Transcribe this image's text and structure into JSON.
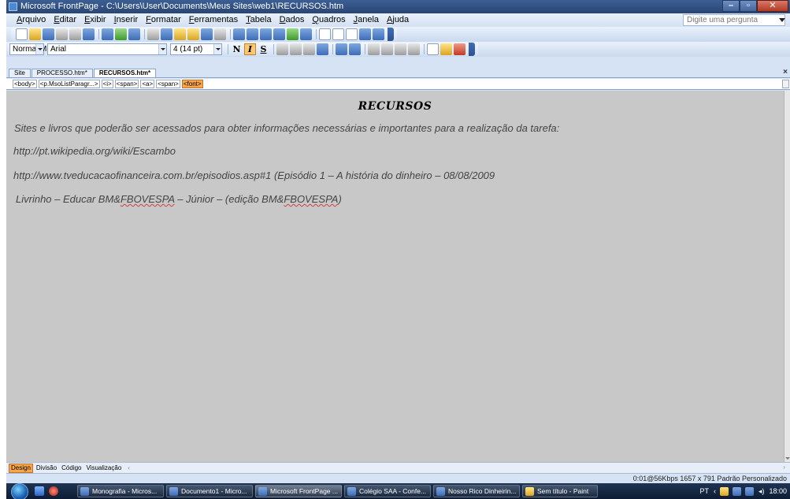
{
  "window": {
    "title": "Microsoft FrontPage - C:\\Users\\User\\Documents\\Meus Sites\\web1\\RECURSOS.htm",
    "controls": {
      "minimize": "–",
      "maximize": "▫",
      "close": "✕"
    }
  },
  "menubar": {
    "items": [
      "Arquivo",
      "Editar",
      "Exibir",
      "Inserir",
      "Formatar",
      "Ferramentas",
      "Tabela",
      "Dados",
      "Quadros",
      "Janela",
      "Ajuda"
    ],
    "help_placeholder": "Digite uma pergunta"
  },
  "format_toolbar": {
    "style_value": "Normal.MsoListI",
    "font_value": "Arial",
    "size_value": "4 (14 pt)",
    "bold_label": "N",
    "italic_label": "I",
    "underline_label": "S"
  },
  "doc_tabs": {
    "items": [
      "Site",
      "PROCESSO.htm*",
      "RECURSOS.htm*"
    ],
    "close": "×"
  },
  "tag_selector": {
    "tags": [
      "<body>",
      "<p.MsoListParagr...>",
      "<i>",
      "<span>",
      "<a>",
      "<span>",
      "<font>"
    ]
  },
  "document": {
    "heading": "RECURSOS",
    "intro": "Sites e livros que poderão ser acessados para obter informações necessárias e importantes para a realização da tarefa:",
    "link1": "http://pt.wikipedia.org/wiki/Escambo",
    "link2": "http://www.tveducacaofinanceira.com.br/episodios.asp#1 (Episódio 1 – A história do dinheiro – 08/08/2009",
    "book_prefix": "Livrinho – Educar BM&",
    "book_brand1": "FBOVESPA",
    "book_middle": " – Júnior – (edição BM&",
    "book_brand2": "FBOVESPA",
    "book_suffix": ")"
  },
  "view_tabs": [
    "Design",
    "Divisão",
    "Código",
    "Visualização"
  ],
  "status": {
    "text": "0:01@56Kbps   1657 x 791   Padrão   Personalizado"
  },
  "taskbar": {
    "tasks": [
      "Monografia - Micros...",
      "Documento1 - Micro...",
      "Microsoft FrontPage ...",
      "Colégio SAA - Confe...",
      "Nosso Rico Dinheirin...",
      "Sem título - Paint"
    ],
    "language": "PT",
    "clock": "18:00"
  },
  "colors": {
    "design_background": "#c8c8c8",
    "selected_tag": "#f7a64a",
    "title_bar": "#2a4673"
  }
}
